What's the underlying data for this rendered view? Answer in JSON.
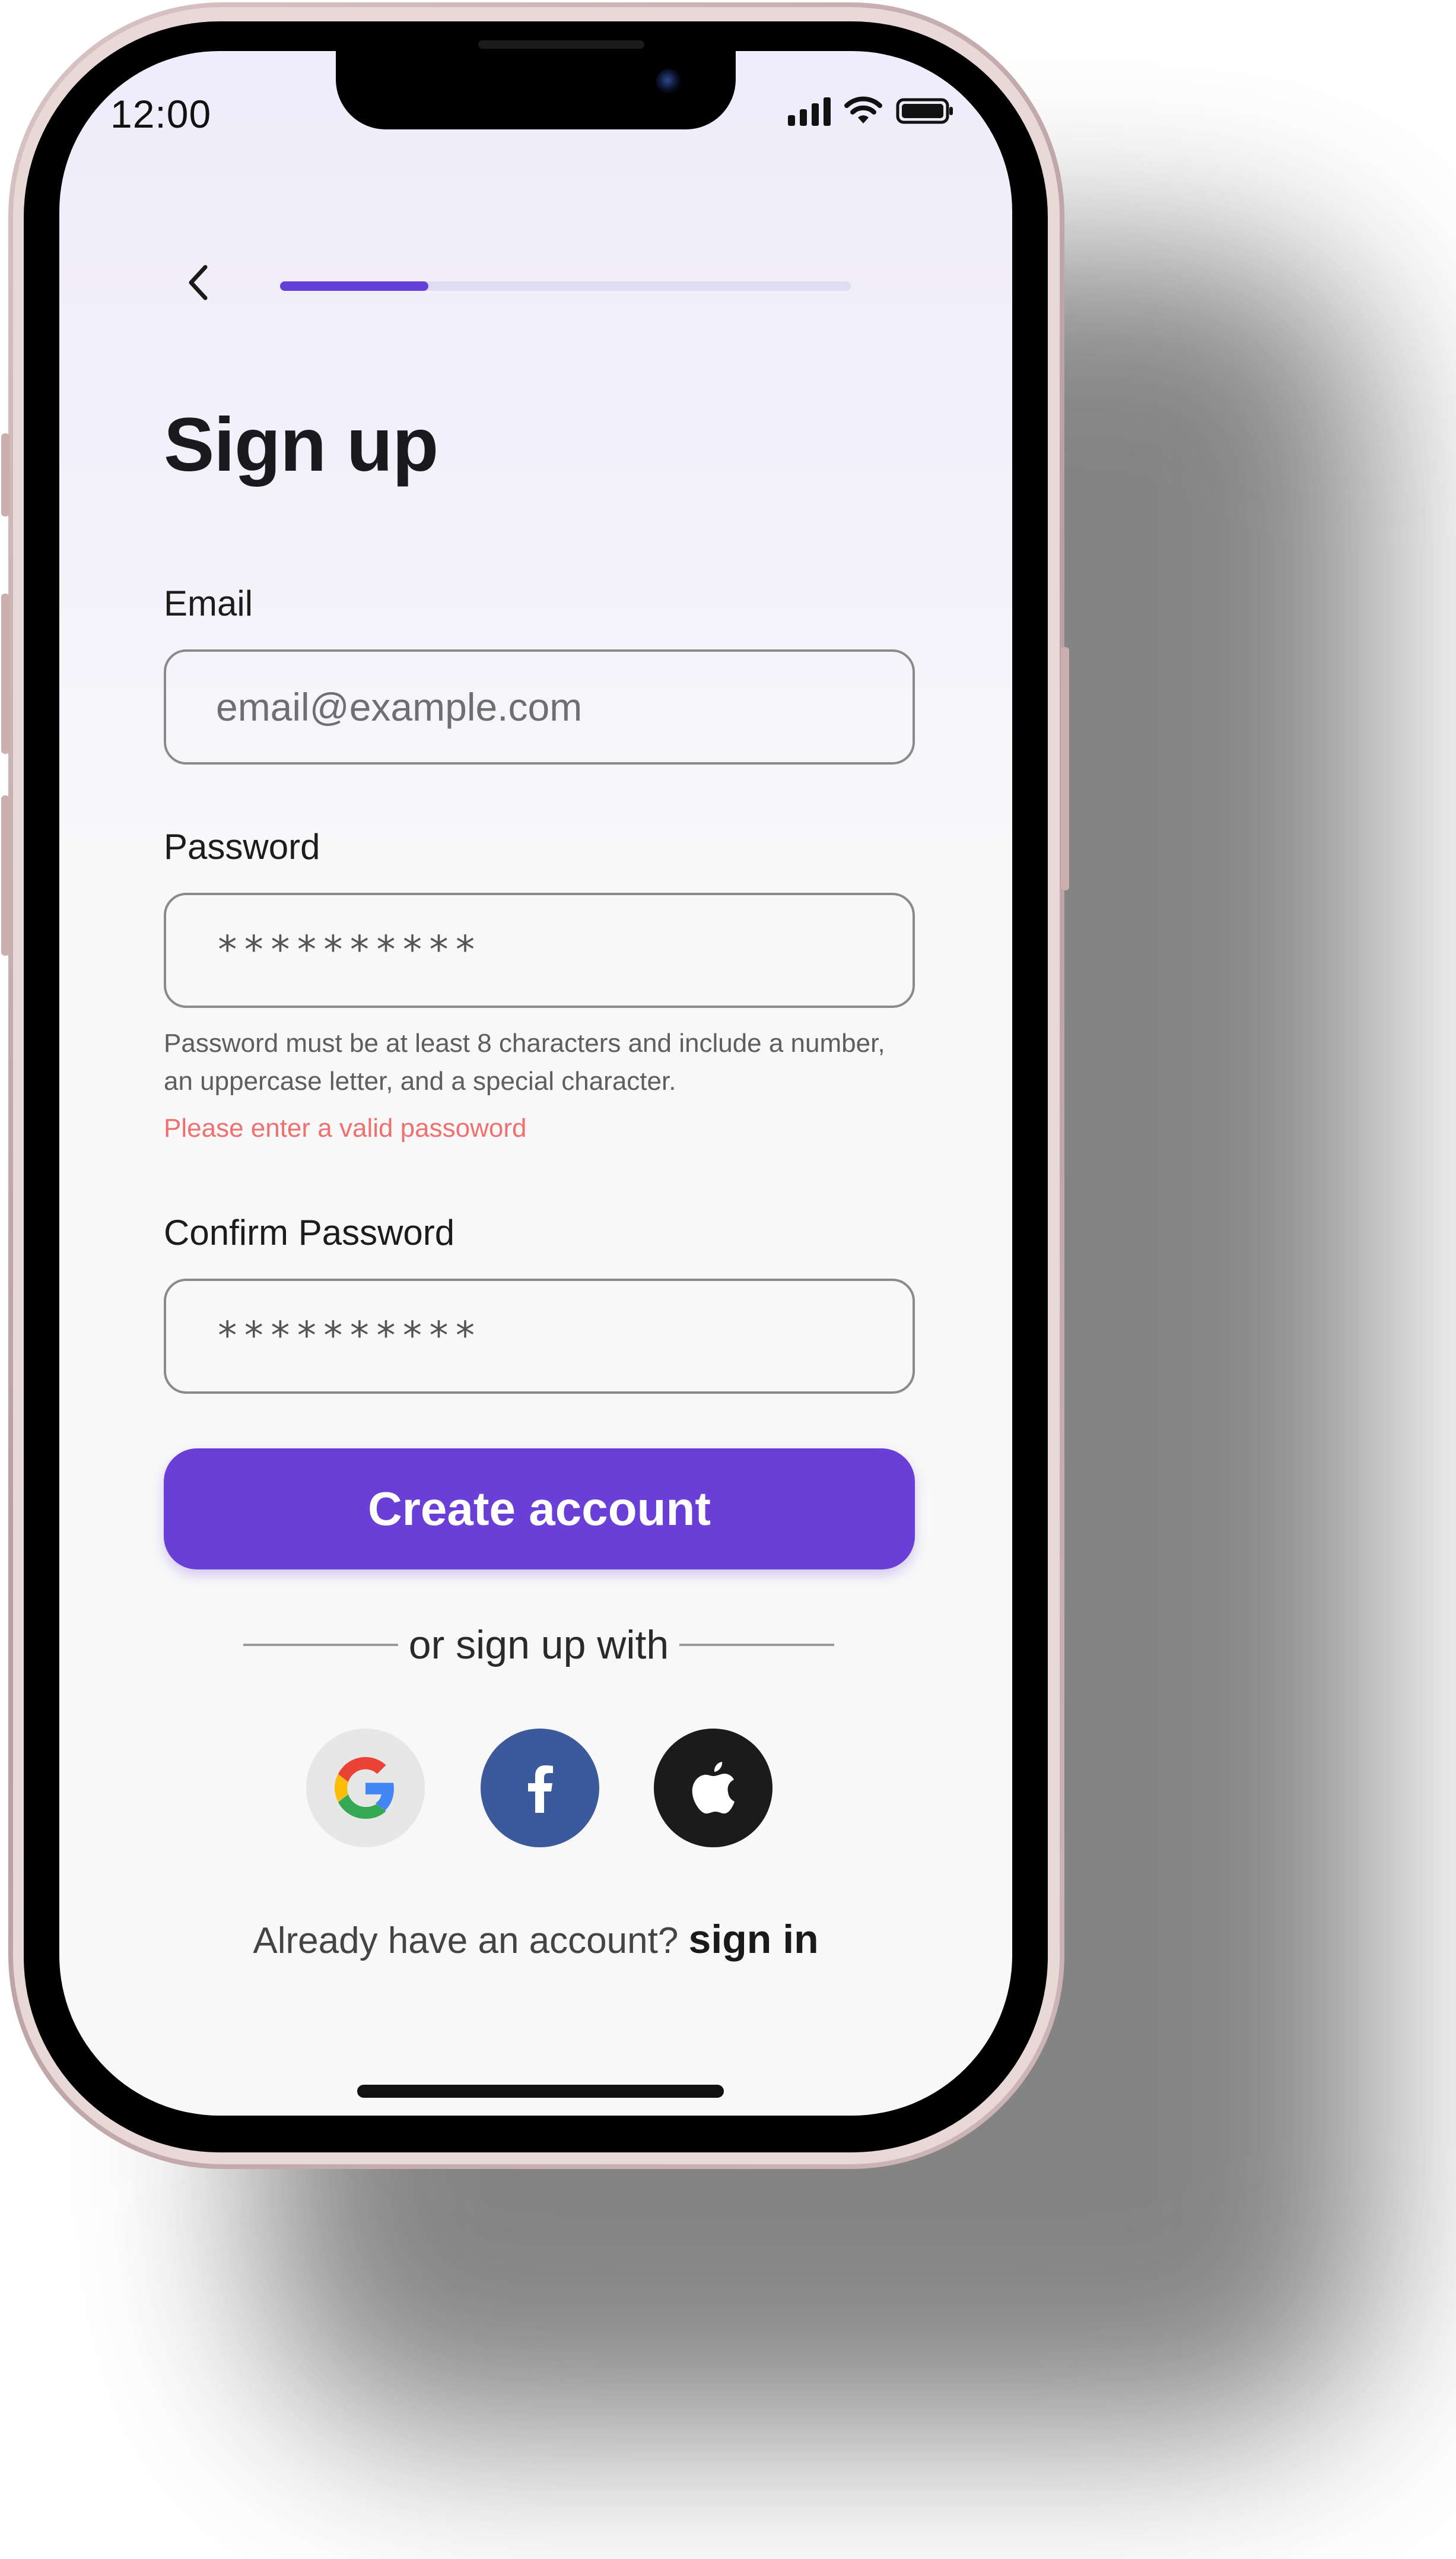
{
  "status_bar": {
    "time": "12:00",
    "signal_icon": "cellular-signal-icon",
    "wifi_icon": "wifi-icon",
    "battery_icon": "battery-icon"
  },
  "header": {
    "back_icon": "chevron-left-icon",
    "progress": 0.26
  },
  "title": "Sign up",
  "form": {
    "email": {
      "label": "Email",
      "placeholder": "email@example.com",
      "value": ""
    },
    "password": {
      "label": "Password",
      "value": "**********",
      "hint": "Password must be at least 8 characters and include a number, an uppercase letter, and a special character.",
      "error": "Please enter a valid passoword"
    },
    "confirm_password": {
      "label": "Confirm Password",
      "value": "**********"
    },
    "submit_label": "Create account"
  },
  "social": {
    "divider_text": "or sign up with",
    "providers": [
      "google",
      "facebook",
      "apple"
    ]
  },
  "footer": {
    "prompt": "Already have an account?",
    "link_label": "sign in"
  },
  "colors": {
    "accent": "#6a3fd8",
    "error": "#f07070",
    "facebook": "#3b5a9c",
    "apple": "#1b1b1b"
  }
}
